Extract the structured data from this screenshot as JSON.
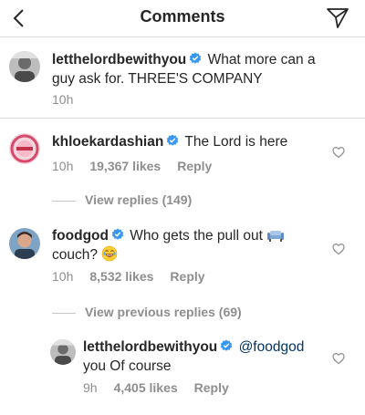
{
  "header": {
    "title": "Comments"
  },
  "caption": {
    "username": "letthelordbewithyou",
    "text_line1": "What more can a",
    "text_line2": "guy ask for.  THREE'S COMPANY",
    "time": "10h"
  },
  "comments": [
    {
      "username": "khloekardashian",
      "text": "The Lord is here",
      "time": "10h",
      "likes": "19,367 likes",
      "reply_label": "Reply",
      "view_replies": "View replies (149)"
    },
    {
      "username": "foodgod",
      "text_line1": "Who gets the pull out",
      "text_line2": "couch?",
      "time": "10h",
      "likes": "8,532 likes",
      "reply_label": "Reply",
      "view_replies": "View previous replies (69)"
    }
  ],
  "reply": {
    "username": "letthelordbewithyou",
    "mention": "@foodgod",
    "text_line2": "you Of course",
    "time": "9h",
    "likes": "4,405 likes",
    "reply_label": "Reply"
  },
  "colors": {
    "verified": "#3897f0",
    "meta": "#8e8e8e",
    "divider": "#dbdbdb",
    "mention": "#003569"
  }
}
